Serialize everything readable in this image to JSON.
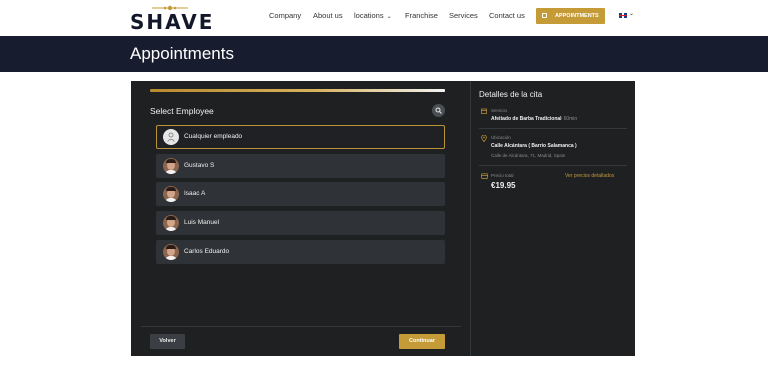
{
  "header": {
    "logo_text": "SHAVE",
    "nav": [
      {
        "label": "Company",
        "has_caret": false
      },
      {
        "label": "About us",
        "has_caret": false
      },
      {
        "label": "locations",
        "has_caret": true
      },
      {
        "label": "Franchise",
        "has_caret": false
      },
      {
        "label": "Services",
        "has_caret": false
      },
      {
        "label": "Contact us",
        "has_caret": false
      }
    ],
    "appointments_label": "APPOINTMENTS",
    "language_icon": "uk-flag-icon"
  },
  "banner": {
    "title": "Appointments"
  },
  "booking": {
    "step_title": "Select Employee",
    "employees": [
      {
        "name": "Cualquier empleado",
        "selected": true,
        "avatar": "user-icon"
      },
      {
        "name": "Gustavo S",
        "selected": false,
        "avatar": "photo"
      },
      {
        "name": "Isaac A",
        "selected": false,
        "avatar": "photo"
      },
      {
        "name": "Luis Manuel",
        "selected": false,
        "avatar": "photo"
      },
      {
        "name": "Carlos Eduardo",
        "selected": false,
        "avatar": "photo"
      }
    ],
    "back_label": "Volver",
    "continue_label": "Continuar"
  },
  "details": {
    "title": "Detalles de la cita",
    "service_label": "Servicio",
    "service_value": "Afeitado de Barba Tradicional",
    "service_duration": "60min",
    "location_label": "Ubicación",
    "location_value": "Calle Alcántara ( Barrio Salamanca )",
    "location_address": "Calle de Alcántara, 71, Madrid, Spain",
    "price_label": "Precio total",
    "price_link": "Ver precios detallados",
    "price_value": "€19.95"
  },
  "colors": {
    "accent": "#c49b37",
    "banner": "#171c2e",
    "panel": "#1e2022",
    "row": "#2f3236"
  }
}
